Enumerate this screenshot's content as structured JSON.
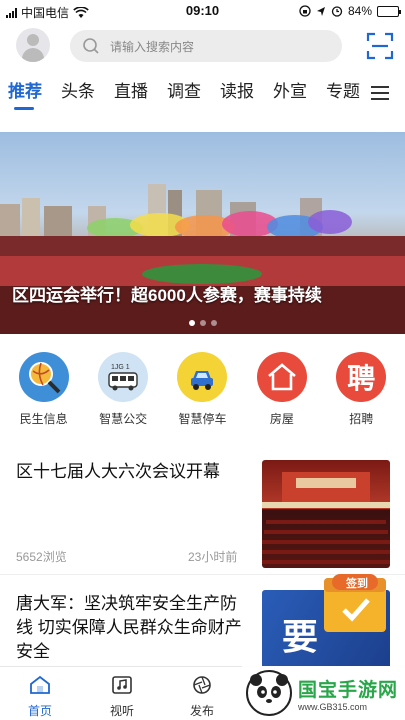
{
  "status_bar": {
    "carrier": "中国电信",
    "time": "09:10",
    "battery": "84%",
    "battery_level": 0.84
  },
  "header": {
    "search_placeholder": "请输入搜索内容"
  },
  "tabs": [
    {
      "label": "推荐",
      "active": true
    },
    {
      "label": "头条"
    },
    {
      "label": "直播"
    },
    {
      "label": "调查"
    },
    {
      "label": "读报"
    },
    {
      "label": "外宣"
    },
    {
      "label": "专题"
    }
  ],
  "banner": {
    "caption": "区四运会举行！超6000人参赛，赛事持续"
  },
  "quick_links": [
    {
      "label": "民生信息",
      "color": "#3e8ed8",
      "icon": "magnifier-volleyball-icon"
    },
    {
      "label": "智慧公交",
      "color": "#cfe3f4",
      "icon": "bus-icon",
      "badge": "1JG 1"
    },
    {
      "label": "智慧停车",
      "color": "#f3d335",
      "icon": "car-icon"
    },
    {
      "label": "房屋",
      "color": "#e84a3c",
      "icon": "house-icon"
    },
    {
      "label": "招聘",
      "color": "#e84a3c",
      "icon": "hire-icon",
      "glyph": "聘"
    }
  ],
  "news": [
    {
      "title": "区十七届人大六次会议开幕",
      "views": "5652浏览",
      "time": "23小时前"
    },
    {
      "title": "唐大军：坚决筑牢安全生产防线 切实保障人民群众生命财产安全",
      "thumb_text": "要"
    }
  ],
  "signin": {
    "label": "签到"
  },
  "bottom_nav": [
    {
      "label": "首页",
      "active": true,
      "icon": "home-icon"
    },
    {
      "label": "视听",
      "icon": "music-note-icon"
    },
    {
      "label": "发布",
      "icon": "aperture-icon"
    }
  ],
  "watermark": {
    "title": "国宝手游网",
    "url": "www.GB315.com"
  },
  "colors": {
    "accent": "#1f67d2",
    "red": "#e84a3c"
  }
}
